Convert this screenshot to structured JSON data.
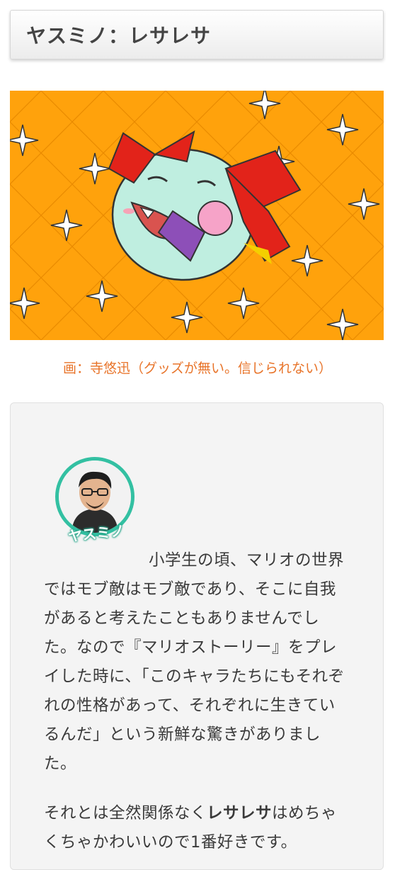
{
  "header": {
    "title": "ヤスミノ：レサレサ"
  },
  "illustration": {
    "alt": "Cartoon ghost character with red bows holding a fan",
    "bg_color": "#ffa20c"
  },
  "caption": "画：寺悠迅（グッズが無い。信じられない）",
  "comment": {
    "author_badge": "ヤスミノ",
    "paragraph1": "小学生の頃、マリオの世界ではモブ敵はモブ敵であり、そこに自我があると考えたこともありませんでした。なので『マリオストーリー』をプレイした時に、「このキャラたちにもそれぞれの性格があって、それぞれに生きているんだ」という新鮮な驚きがありました。",
    "paragraph2_pre": "それとは全然関係なく",
    "paragraph2_bold": "レサレサ",
    "paragraph2_post": "はめちゃくちゃかわいいので1番好きです。"
  },
  "colors": {
    "accent_orange": "#e8742a",
    "avatar_ring": "#33c0a2"
  }
}
